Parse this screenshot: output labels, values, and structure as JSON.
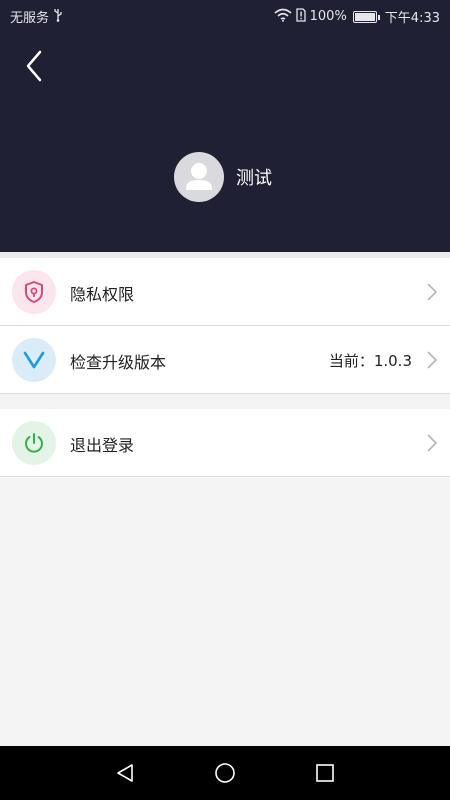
{
  "status_bar": {
    "carrier": "无服务",
    "battery": "100%",
    "time": "下午4:33"
  },
  "header": {
    "username": "测试"
  },
  "menu": {
    "privacy": {
      "label": "隐私权限",
      "icon": "shield-icon",
      "icon_color": "#e0457b",
      "bg": "#fbe6ee"
    },
    "update": {
      "label": "检查升级版本",
      "value": "当前：1.0.3",
      "icon": "v-check-icon",
      "icon_color": "#1e9be0",
      "bg": "#d9ecf8"
    },
    "logout": {
      "label": "退出登录",
      "icon": "power-icon",
      "icon_color": "#33b04c",
      "bg": "#e3f4e6"
    }
  },
  "colors": {
    "header_bg": "#1f2033",
    "page_bg": "#f4f4f4"
  }
}
